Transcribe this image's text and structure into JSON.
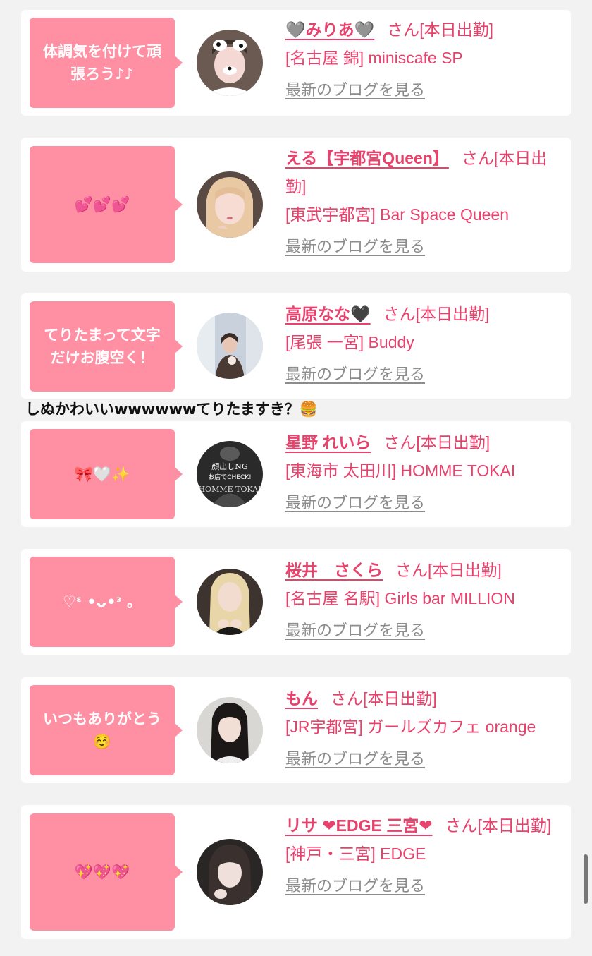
{
  "cards": [
    {
      "message": "体調気を付けて頑張ろう♪♪",
      "name": "🩶みりあ🩶",
      "san": "さん[本日出勤]",
      "shop": "[名古屋 錦] miniscafe SP",
      "blog": "最新のブログを見る"
    },
    {
      "message": "💕💕💕",
      "name": "える【宇都宮Queen】",
      "san": "さん[本日出勤]",
      "shop": "[東武宇都宮] Bar Space Queen",
      "blog": "最新のブログを見る"
    },
    {
      "message": "てりたまって文字だけお腹空く！",
      "name": "高原なな🖤",
      "san": "さん[本日出勤]",
      "shop": "[尾張 一宮] Buddy",
      "blog": "最新のブログを見る"
    },
    {
      "message": "🎀🤍✨",
      "name": "星野 れいら",
      "san": "さん[本日出勤]",
      "shop": "[東海市 太田川] HOMME TOKAI",
      "blog": "最新のブログを見る"
    },
    {
      "message": "♡ᵋ •ᴗ•ᵌ 。",
      "name": "桜井　さくら",
      "san": "さん[本日出勤]",
      "shop": "[名古屋 名駅] Girls bar MILLION",
      "blog": "最新のブログを見る"
    },
    {
      "message": "いつもありがとう☺️",
      "name": "もん",
      "san": "さん[本日出勤]",
      "shop": "[JR宇都宮] ガールズカフェ orange",
      "blog": "最新のブログを見る"
    },
    {
      "message": "💖💖💖",
      "name": "リサ ❤EDGE 三宮❤",
      "san": "さん[本日出勤]",
      "shop": "[神戸・三宮] EDGE",
      "blog": "最新のブログを見る"
    }
  ],
  "overlay_comment": "しぬかわいいwwwwwwてりたますき？🍔",
  "avatar4_text": "顔出しNG お店でCHECK! HOMME TOKAI",
  "colors": {
    "page_bg": "#f2f2f2",
    "bubble": "#ff8fa3",
    "link": "#e8416c",
    "muted": "#8c8c8c"
  },
  "icons": [
    "speech-bubble-tail",
    "avatar-photo"
  ]
}
